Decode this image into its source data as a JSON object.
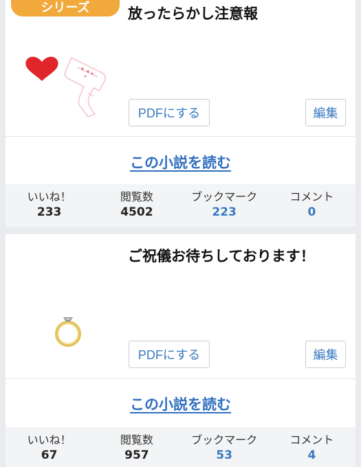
{
  "cards": [
    {
      "badge": "シリーズ",
      "title": "放ったらかし注意報",
      "thumbnail_icons": [
        "heart-icon",
        "gun-icon"
      ],
      "pdf_label": "PDFにする",
      "edit_label": "編集",
      "read_label": "この小説を読む",
      "stats": [
        {
          "label": "いいね！",
          "value": "233"
        },
        {
          "label": "閲覧数",
          "value": "4502"
        },
        {
          "label": "ブックマーク",
          "value": "223"
        },
        {
          "label": "コメント",
          "value": "0"
        }
      ]
    },
    {
      "title": "ご祝儀お待ちしております！",
      "thumbnail_icons": [
        "ring-icon"
      ],
      "pdf_label": "PDFにする",
      "edit_label": "編集",
      "read_label": "この小説を読む",
      "stats": [
        {
          "label": "いいね！",
          "value": "67"
        },
        {
          "label": "閲覧数",
          "value": "957"
        },
        {
          "label": "ブックマーク",
          "value": "53"
        },
        {
          "label": "コメント",
          "value": "4"
        }
      ]
    }
  ],
  "colors": {
    "badge": "#f2a93b",
    "link": "#2f6fbf",
    "heart": "#e0262a",
    "ring_gold": "#e3c35a"
  }
}
